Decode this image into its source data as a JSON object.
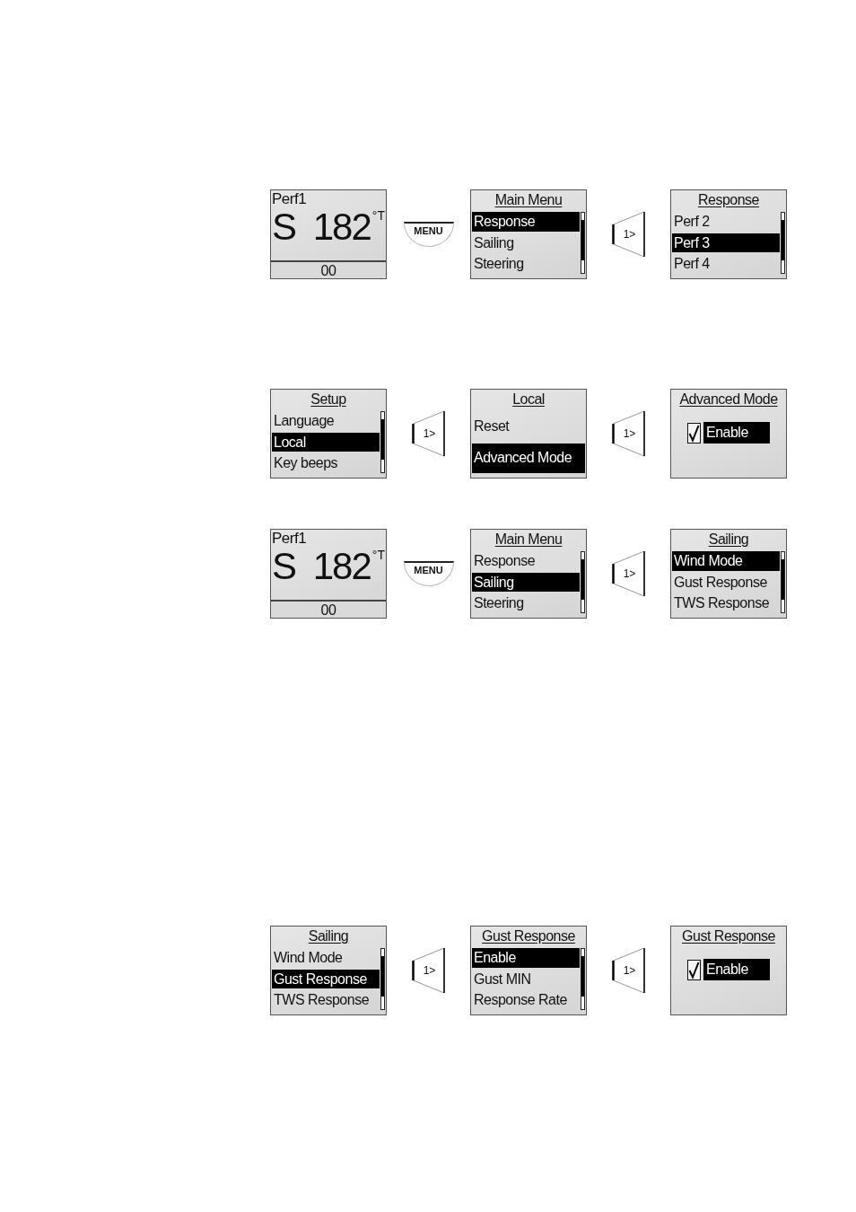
{
  "rows": [
    {
      "screens": [
        {
          "kind": "readout",
          "mode": "Perf1",
          "direction": "S",
          "heading": "182",
          "unit": "°T",
          "footer": "00"
        },
        {
          "kind": "menu",
          "title": "Main Menu",
          "scrollbar": true,
          "items": [
            {
              "label": "Response",
              "selected": true
            },
            {
              "label": "Sailing",
              "selected": false
            },
            {
              "label": "Steering",
              "selected": false
            }
          ]
        },
        {
          "kind": "menu",
          "title": "Response",
          "scrollbar": true,
          "items": [
            {
              "label": "Perf 2",
              "selected": false
            },
            {
              "label": "Perf 3",
              "selected": true
            },
            {
              "label": "Perf 4",
              "selected": false
            }
          ]
        }
      ],
      "keys": [
        {
          "kind": "menu",
          "label": "MENU"
        },
        {
          "kind": "arrow",
          "label": "1>"
        }
      ]
    },
    {
      "screens": [
        {
          "kind": "menu",
          "title": "Setup",
          "scrollbar": true,
          "items": [
            {
              "label": "Language",
              "selected": false
            },
            {
              "label": "Local",
              "selected": true
            },
            {
              "label": "Key beeps",
              "selected": false
            }
          ]
        },
        {
          "kind": "menu",
          "title": "Local",
          "items": [
            {
              "label": "Reset",
              "selected": false
            },
            {
              "label": "Advanced Mode",
              "selected": true
            }
          ]
        },
        {
          "kind": "option",
          "title": "Advanced Mode",
          "option": {
            "label": "Enable",
            "checked": true,
            "selected": true
          }
        }
      ],
      "keys": [
        {
          "kind": "arrow",
          "label": "1>"
        },
        {
          "kind": "arrow",
          "label": "1>"
        }
      ]
    },
    {
      "screens": [
        {
          "kind": "readout",
          "mode": "Perf1",
          "direction": "S",
          "heading": "182",
          "unit": "°T",
          "footer": "00"
        },
        {
          "kind": "menu",
          "title": "Main Menu",
          "scrollbar": true,
          "items": [
            {
              "label": "Response",
              "selected": false
            },
            {
              "label": "Sailing",
              "selected": true
            },
            {
              "label": "Steering",
              "selected": false
            }
          ]
        },
        {
          "kind": "menu",
          "title": "Sailing",
          "scrollbar": true,
          "items": [
            {
              "label": "Wind Mode",
              "selected": true
            },
            {
              "label": "Gust Response",
              "selected": false
            },
            {
              "label": "TWS Response",
              "selected": false
            }
          ]
        }
      ],
      "keys": [
        {
          "kind": "menu",
          "label": "MENU"
        },
        {
          "kind": "arrow",
          "label": "1>"
        }
      ]
    },
    {
      "screens": [
        {
          "kind": "menu",
          "title": "Sailing",
          "scrollbar": true,
          "items": [
            {
              "label": "Wind Mode",
              "selected": false
            },
            {
              "label": "Gust Response",
              "selected": true
            },
            {
              "label": "TWS Response",
              "selected": false
            }
          ]
        },
        {
          "kind": "menu",
          "title": "Gust Response",
          "scrollbar": true,
          "items": [
            {
              "label": "Enable",
              "selected": true
            },
            {
              "label": "Gust MIN",
              "selected": false
            },
            {
              "label": "Response Rate",
              "selected": false
            }
          ]
        },
        {
          "kind": "option",
          "title": "Gust Response",
          "option": {
            "label": "Enable",
            "checked": true,
            "selected": true
          }
        }
      ],
      "keys": [
        {
          "kind": "arrow",
          "label": "1>"
        },
        {
          "kind": "arrow",
          "label": "1>"
        }
      ]
    }
  ]
}
